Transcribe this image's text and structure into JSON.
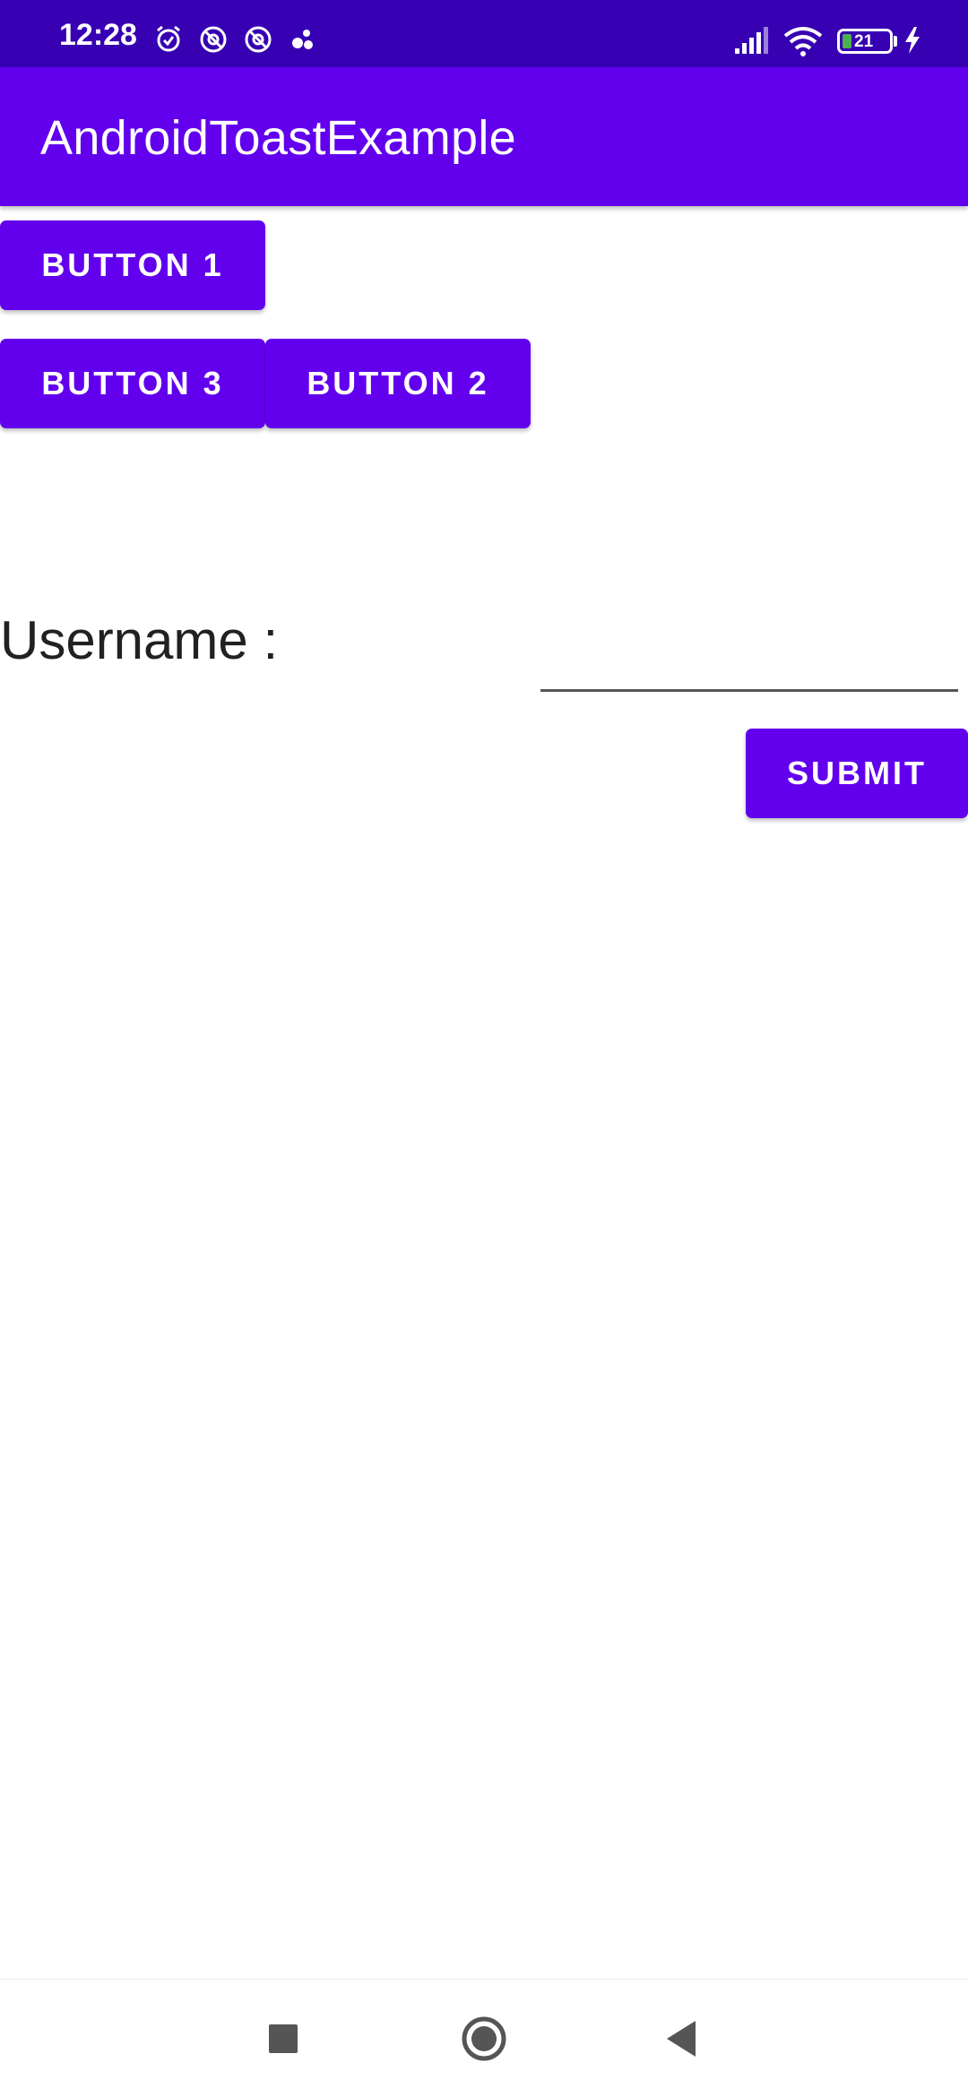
{
  "status_bar": {
    "time": "12:28",
    "battery_level": "21",
    "icons": [
      "alarm-icon",
      "at-sign-icon",
      "at-sign-icon",
      "app-icon",
      "signal-icon",
      "wifi-icon",
      "battery-icon",
      "charging-icon"
    ]
  },
  "app_bar": {
    "title": "AndroidToastExample"
  },
  "buttons": {
    "button1": "BUTTON 1",
    "button3": "BUTTON 3",
    "button2": "BUTTON 2",
    "submit": "SUBMIT"
  },
  "form": {
    "username_label": "Username :",
    "username_value": ""
  },
  "nav_bar": {
    "icons": [
      "recents-icon",
      "home-icon",
      "back-icon"
    ]
  },
  "colors": {
    "status_bar": "#3700b3",
    "primary": "#6200ee",
    "text": "#212121",
    "background": "#ffffff"
  }
}
